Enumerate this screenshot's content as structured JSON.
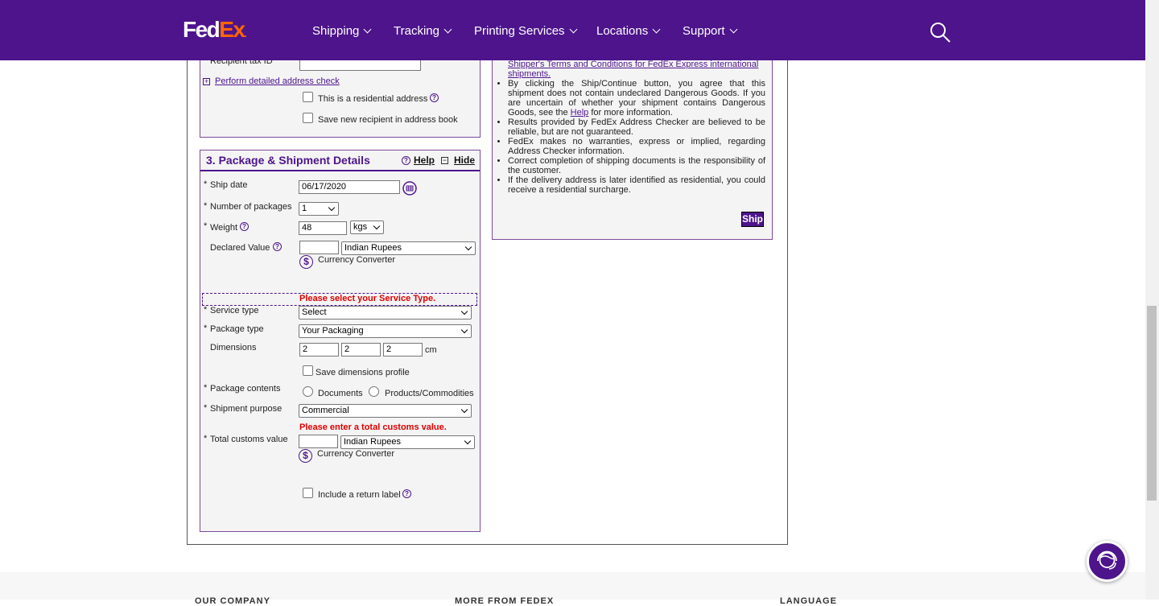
{
  "header": {
    "logo_fed": "Fed",
    "logo_ex": "Ex",
    "logo_dot": ".",
    "nav": [
      "Shipping",
      "Tracking",
      "Printing Services",
      "Locations",
      "Support"
    ]
  },
  "recipient": {
    "tax_id_label": "Recipient tax ID",
    "detailed_check_link": "Perform detailed address check",
    "residential_label": "This is a residential address",
    "save_recipient_label": "Save new recipient in address book"
  },
  "package": {
    "title": "3. Package & Shipment Details",
    "help": "Help",
    "hide": "Hide",
    "ship_date_label": "Ship date",
    "ship_date_value": "06/17/2020",
    "num_packages_label": "Number of packages",
    "num_packages_value": "1",
    "weight_label": "Weight",
    "weight_value": "48",
    "weight_unit": "kgs",
    "declared_value_label": "Declared Value",
    "declared_value": "",
    "declared_currency": "Indian Rupees",
    "currency_converter": "Currency Converter",
    "service_error": "Please select your Service Type.",
    "service_type_label": "Service type",
    "service_type_value": "Select",
    "package_type_label": "Package type",
    "package_type_value": "Your Packaging",
    "dimensions_label": "Dimensions",
    "dim_l": "2",
    "dim_w": "2",
    "dim_h": "2",
    "dim_unit": "cm",
    "save_dimensions_label": "Save dimensions profile",
    "contents_label": "Package contents",
    "contents_documents": "Documents",
    "contents_products": "Products/Commodities",
    "purpose_label": "Shipment purpose",
    "purpose_value": "Commercial",
    "customs_error": "Please enter a total customs value.",
    "customs_label": "Total customs value",
    "customs_value": "",
    "customs_currency": "Indian Rupees",
    "currency_converter_2": "Currency Converter",
    "return_label": "Include a return label"
  },
  "terms": {
    "link_line": "Shipper's Terms and Conditions for FedEx Express international shipments.",
    "b1_pre": "By clicking the Ship/Continue button, you agree that this shipment does not contain undeclared Dangerous Goods. If you are uncertain of whether your shipment contains Dangerous Goods, see the ",
    "b1_link": "Help",
    "b1_post": " for more information.",
    "b2": "Results provided by FedEx Address Checker are believed to be reliable, but are not guaranteed.",
    "b3": "FedEx makes no warranties, express or implied, regarding Address Checker information.",
    "b4": "Correct completion of shipping documents is the responsibility of the customer.",
    "b5": "If the delivery address is later identified as residential, you could receive a residential surcharge.",
    "ship_button": "Ship"
  },
  "footer": {
    "col1": "OUR COMPANY",
    "col2": "MORE FROM FEDEX",
    "col3": "LANGUAGE"
  },
  "colors": {
    "brand_purple": "#4d148c",
    "brand_orange": "#ff6600",
    "error_red": "#dd0000"
  }
}
